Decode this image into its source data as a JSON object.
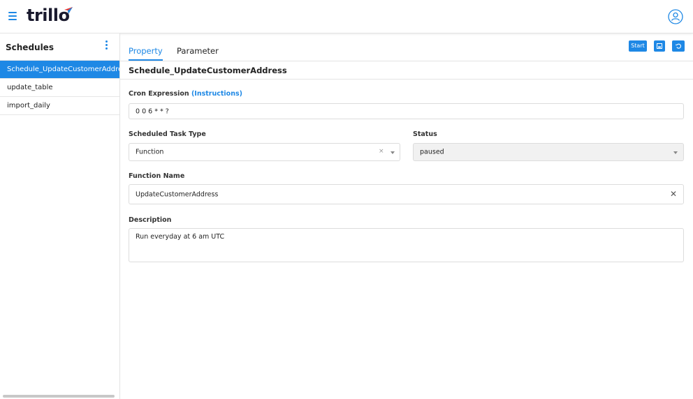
{
  "header": {
    "logo_text": "trillo",
    "menu_icon": "hamburger-icon",
    "user_icon": "user-avatar-icon",
    "accent_color": "#1e88e5"
  },
  "sidebar": {
    "title": "Schedules",
    "items": [
      {
        "label": "Schedule_UpdateCustomerAddress",
        "active": true
      },
      {
        "label": "update_table",
        "active": false
      },
      {
        "label": "import_daily",
        "active": false
      }
    ]
  },
  "tabs": [
    {
      "label": "Property",
      "active": true
    },
    {
      "label": "Parameter",
      "active": false
    }
  ],
  "toolbar": {
    "start_label": "Start",
    "save_icon": "save-icon",
    "refresh_icon": "refresh-icon"
  },
  "form": {
    "schedule_name": "Schedule_UpdateCustomerAddress",
    "cron_label": "Cron Expression",
    "cron_link": "(Instructions)",
    "cron_value": "0 0 6 * * ?",
    "task_type_label": "Scheduled Task Type",
    "task_type_value": "Function",
    "task_type_clear": "×",
    "status_label": "Status",
    "status_value": "paused",
    "function_name_label": "Function Name",
    "function_name_value": "UpdateCustomerAddress",
    "function_name_clear": "✕",
    "description_label": "Description",
    "description_value": "Run everyday at 6 am UTC"
  }
}
